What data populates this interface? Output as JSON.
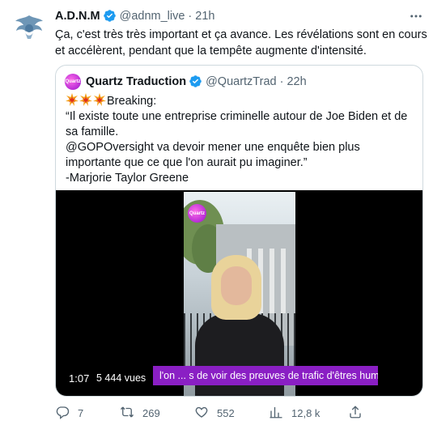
{
  "tweet": {
    "author_name": "A.D.N.M",
    "handle": "@adnm_live",
    "separator": "·",
    "time": "21h",
    "text": "Ça, c'est très très important et ça avance. Les révélations sont en cours et accélèrent, pendant que la tempête augmente d'intensité."
  },
  "quote": {
    "author_name": "Quartz Traduction",
    "handle": "@QuartzTrad",
    "separator": "·",
    "time": "22h",
    "avatar_text": "Quartz",
    "lines": [
      "Breaking:",
      "“Il existe toute une entreprise criminelle autour de Joe Biden et de sa famille.",
      "@GOPOversight va devoir mener une enquête bien plus importante que ce que l'on aurait pu imaginer.”",
      "-Marjorie Taylor Greene"
    ],
    "video": {
      "logo_text": "Quartz",
      "subtitle": "l'on ... s de voir des preuves de trafic d'êtres humains.",
      "duration": "1:07",
      "views": "5 444 vues"
    }
  },
  "actions": {
    "replies": "7",
    "retweets": "269",
    "likes": "552",
    "views": "12,8 k"
  },
  "colors": {
    "verified": "#1d9bf0",
    "secondary_text": "#536471",
    "subtitle_bg": "#8a1fc4",
    "border": "#cfd9de"
  },
  "icons": [
    "verified-badge-icon",
    "more-options-icon",
    "explosion-emoji-icon",
    "reply-icon",
    "retweet-icon",
    "like-icon",
    "views-icon",
    "share-icon"
  ]
}
